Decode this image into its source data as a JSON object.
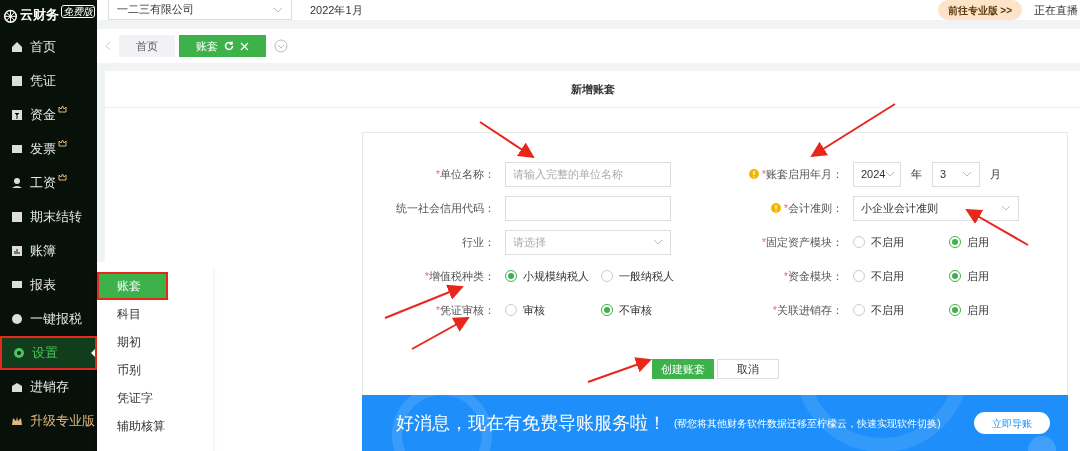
{
  "app": {
    "logo": "云财务",
    "edition": "免费版"
  },
  "sidebar": {
    "items": [
      {
        "label": "首页",
        "premium": false,
        "selected": false,
        "highlighted": false
      },
      {
        "label": "凭证",
        "premium": false,
        "selected": false,
        "highlighted": false
      },
      {
        "label": "资金",
        "premium": true,
        "selected": false,
        "highlighted": false
      },
      {
        "label": "发票",
        "premium": true,
        "selected": false,
        "highlighted": false
      },
      {
        "label": "工资",
        "premium": true,
        "selected": false,
        "highlighted": false
      },
      {
        "label": "期末结转",
        "premium": false,
        "selected": false,
        "highlighted": false
      },
      {
        "label": "账簿",
        "premium": false,
        "selected": false,
        "highlighted": false
      },
      {
        "label": "报表",
        "premium": false,
        "selected": false,
        "highlighted": false
      },
      {
        "label": "一键报税",
        "premium": false,
        "selected": false,
        "highlighted": false
      },
      {
        "label": "设置",
        "premium": false,
        "selected": true,
        "highlighted": true
      },
      {
        "label": "进销存",
        "premium": false,
        "selected": false,
        "highlighted": false
      },
      {
        "label": "升级专业版",
        "premium": false,
        "selected": false,
        "highlighted": false
      }
    ],
    "submenu": [
      {
        "label": "账套",
        "selected": true,
        "highlighted": true
      },
      {
        "label": "科目",
        "selected": false,
        "highlighted": false
      },
      {
        "label": "期初",
        "selected": false,
        "highlighted": false
      },
      {
        "label": "币别",
        "selected": false,
        "highlighted": false
      },
      {
        "label": "凭证字",
        "selected": false,
        "highlighted": false
      },
      {
        "label": "辅助核算",
        "selected": false,
        "highlighted": false
      }
    ]
  },
  "topbar": {
    "company": "一二三有限公司",
    "period": "2022年1月",
    "upgrade_button": "前往专业版 >>",
    "live": "正在直播"
  },
  "tabs": [
    {
      "label": "首页",
      "selected": false
    },
    {
      "label": "账套",
      "selected": true
    }
  ],
  "dialog": {
    "title": "新增账套",
    "left_fields": [
      {
        "kind": "input",
        "mark": "*",
        "label": "单位名称：",
        "placeholder": "请输入完整的单位名称"
      },
      {
        "kind": "input",
        "label": "统一社会信用代码："
      },
      {
        "kind": "select",
        "label": "行业：",
        "placeholder": "请选择"
      },
      {
        "kind": "radio",
        "mark": "*",
        "label": "增值税种类：",
        "options": [
          {
            "label": "小规模纳税人",
            "selected": true
          },
          {
            "label": "一般纳税人",
            "selected": false
          }
        ]
      },
      {
        "kind": "radio",
        "mark": "*",
        "label": "凭证审核：",
        "options": [
          {
            "label": "审核",
            "selected": false
          },
          {
            "label": "不审核",
            "selected": true
          }
        ]
      }
    ],
    "right_fields": [
      {
        "kind": "date",
        "warning": true,
        "mark": "*",
        "label": "账套启用年月：",
        "year": "2024",
        "year_unit": "年",
        "month": "3",
        "month_unit": "月"
      },
      {
        "kind": "select",
        "warning": true,
        "mark": "*",
        "label": "会计准则：",
        "value": "小企业会计准则"
      },
      {
        "kind": "radio",
        "mark": "*",
        "label": "固定资产模块：",
        "options": [
          {
            "label": "不启用",
            "selected": false
          },
          {
            "label": "启用",
            "selected": true
          }
        ]
      },
      {
        "kind": "radio",
        "mark": "*",
        "label": "资金模块：",
        "options": [
          {
            "label": "不启用",
            "selected": false
          },
          {
            "label": "启用",
            "selected": true
          }
        ]
      },
      {
        "kind": "radio",
        "mark": "*",
        "label": "关联进销存：",
        "options": [
          {
            "label": "不启用",
            "selected": false
          },
          {
            "label": "启用",
            "selected": true
          }
        ]
      }
    ],
    "buttons": [
      {
        "label": "创建账套",
        "primary": true
      },
      {
        "label": "取消",
        "primary": false
      }
    ]
  },
  "banner": {
    "headline": "好消息，现在有免费导账服务啦！",
    "note": "(帮您将其他财务软件数据迁移至柠檬云，快速实现软件切换)",
    "button": "立即导账"
  }
}
